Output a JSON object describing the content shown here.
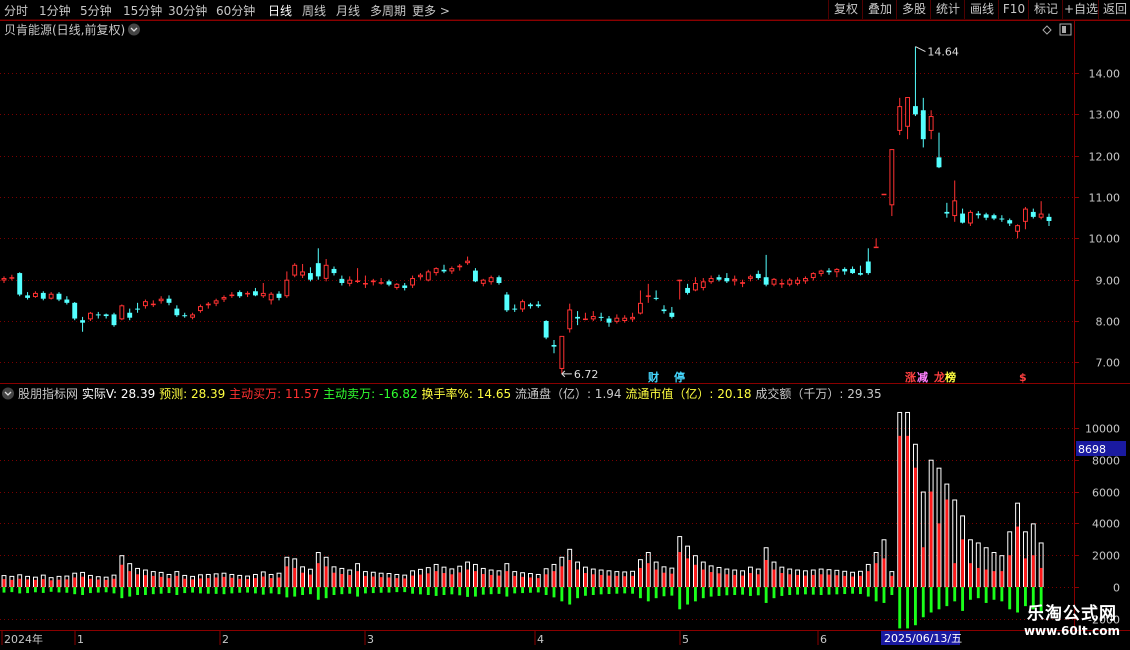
{
  "topbar": {
    "periods": [
      "分时",
      "1分钟",
      "5分钟",
      "15分钟",
      "30分钟",
      "60分钟",
      "日线",
      "周线",
      "月线",
      "多周期",
      "更多 >"
    ],
    "active_period": "日线",
    "right_buttons": [
      "复权",
      "叠加",
      "多股",
      "统计",
      "画线",
      "F10",
      "标记",
      "+自选",
      "返回"
    ]
  },
  "main_panel": {
    "title": "贝肯能源(日线,前复权)",
    "high_label": "14.64",
    "low_label": "6.72",
    "y_ticks": [
      "14.00",
      "13.00",
      "12.00",
      "11.00",
      "10.00",
      "9.00",
      "8.00",
      "7.00"
    ],
    "markers": [
      {
        "text": "财",
        "color": "#46d8ff"
      },
      {
        "text": "停",
        "color": "#46d8ff"
      },
      {
        "text": "涨",
        "color": "#ff4040"
      },
      {
        "text": "减",
        "color": "#ff80ff"
      },
      {
        "text": "龙",
        "color": "#ff4040"
      },
      {
        "text": "榜",
        "color": "#ffff40"
      },
      {
        "text": "$",
        "color": "#ff4040"
      }
    ]
  },
  "indicator_panel": {
    "name": "股朋指标网",
    "items": [
      {
        "label": "实际V",
        "value": "28.39",
        "color": "#ffffff"
      },
      {
        "label": "预测",
        "value": "28.39",
        "color": "#ffff40"
      },
      {
        "label": "主动买万",
        "value": "11.57",
        "color": "#ff3030"
      },
      {
        "label": "主动卖万",
        "value": "-16.82",
        "color": "#30ff30"
      },
      {
        "label": "换手率%",
        "value": "14.65",
        "color": "#ffff40"
      },
      {
        "label": "流通盘（亿）",
        "value": "1.94",
        "color": "#c8c8c8"
      },
      {
        "label": "流通市值（亿）",
        "value": "20.18",
        "color": "#ffff40"
      },
      {
        "label": "成交额（千万）",
        "value": "29.35",
        "color": "#c8c8c8"
      }
    ],
    "y_ticks": [
      "10000",
      "8000",
      "6000",
      "4000",
      "2000",
      "0",
      "-2000"
    ],
    "cursor_value": "8698"
  },
  "date_axis": {
    "labels": [
      "2024年",
      "1",
      "2",
      "3",
      "4",
      "5",
      "6"
    ],
    "current_date": "2025/06/13/五"
  },
  "watermark": {
    "line1": "乐淘公式网",
    "line2": "www.60lt.com"
  },
  "colors": {
    "up": "#ff3232",
    "down": "#54ffff",
    "buy": "#ff1a1a",
    "sell": "#1aff1a",
    "grid": "#7a0000",
    "axis_text": "#c8c8c8"
  },
  "chart_data": {
    "type": "candlestick",
    "y_range": [
      6.5,
      14.8
    ],
    "volume_range": [
      -2700,
      11500
    ],
    "candles": [
      [
        8.98,
        9.08,
        8.92,
        9.04
      ],
      [
        9.04,
        9.12,
        8.98,
        9.06
      ],
      [
        9.16,
        9.18,
        8.6,
        8.64
      ],
      [
        8.62,
        8.7,
        8.52,
        8.56
      ],
      [
        8.58,
        8.72,
        8.56,
        8.68
      ],
      [
        8.68,
        8.72,
        8.5,
        8.54
      ],
      [
        8.54,
        8.7,
        8.52,
        8.66
      ],
      [
        8.66,
        8.7,
        8.48,
        8.52
      ],
      [
        8.52,
        8.6,
        8.4,
        8.44
      ],
      [
        8.44,
        8.46,
        8.02,
        8.06
      ],
      [
        8.02,
        8.1,
        7.74,
        7.96
      ],
      [
        8.04,
        8.22,
        8.0,
        8.2
      ],
      [
        8.16,
        8.22,
        8.06,
        8.14
      ],
      [
        8.16,
        8.18,
        8.06,
        8.12
      ],
      [
        8.16,
        8.2,
        7.86,
        7.9
      ],
      [
        8.04,
        8.4,
        8.02,
        8.38
      ],
      [
        8.2,
        8.3,
        8.02,
        8.08
      ],
      [
        8.3,
        8.44,
        8.2,
        8.28
      ],
      [
        8.36,
        8.52,
        8.3,
        8.48
      ],
      [
        8.4,
        8.5,
        8.34,
        8.42
      ],
      [
        8.48,
        8.6,
        8.42,
        8.54
      ],
      [
        8.54,
        8.62,
        8.38,
        8.44
      ],
      [
        8.3,
        8.38,
        8.1,
        8.14
      ],
      [
        8.14,
        8.2,
        8.08,
        8.12
      ],
      [
        8.08,
        8.2,
        8.04,
        8.16
      ],
      [
        8.24,
        8.4,
        8.2,
        8.36
      ],
      [
        8.38,
        8.46,
        8.3,
        8.42
      ],
      [
        8.42,
        8.54,
        8.36,
        8.5
      ],
      [
        8.52,
        8.62,
        8.46,
        8.58
      ],
      [
        8.62,
        8.7,
        8.56,
        8.64
      ],
      [
        8.7,
        8.74,
        8.56,
        8.6
      ],
      [
        8.66,
        8.72,
        8.58,
        8.68
      ],
      [
        8.72,
        8.8,
        8.6,
        8.62
      ],
      [
        8.6,
        8.92,
        8.56,
        8.68
      ],
      [
        8.5,
        8.7,
        8.4,
        8.66
      ],
      [
        8.66,
        8.72,
        8.5,
        8.56
      ],
      [
        8.6,
        9.2,
        8.56,
        9.0
      ],
      [
        9.1,
        9.4,
        9.06,
        9.36
      ],
      [
        9.1,
        9.38,
        9.04,
        9.2
      ],
      [
        9.16,
        9.3,
        8.96,
        9.0
      ],
      [
        9.4,
        9.76,
        9.0,
        9.08
      ],
      [
        9.02,
        9.5,
        8.96,
        9.36
      ],
      [
        9.26,
        9.32,
        9.1,
        9.16
      ],
      [
        9.02,
        9.1,
        8.86,
        8.92
      ],
      [
        8.9,
        9.08,
        8.84,
        9.0
      ],
      [
        8.96,
        9.28,
        8.92,
        8.98
      ],
      [
        8.9,
        9.1,
        8.8,
        8.92
      ],
      [
        8.94,
        9.02,
        8.86,
        8.98
      ],
      [
        8.92,
        9.04,
        8.88,
        8.94
      ],
      [
        8.96,
        9.0,
        8.84,
        8.88
      ],
      [
        8.8,
        8.92,
        8.76,
        8.9
      ],
      [
        8.86,
        8.92,
        8.74,
        8.8
      ],
      [
        8.86,
        9.1,
        8.8,
        9.04
      ],
      [
        9.06,
        9.16,
        9.0,
        9.12
      ],
      [
        8.98,
        9.24,
        8.96,
        9.2
      ],
      [
        9.16,
        9.3,
        9.1,
        9.28
      ],
      [
        9.24,
        9.36,
        9.16,
        9.2
      ],
      [
        9.2,
        9.32,
        9.14,
        9.28
      ],
      [
        9.3,
        9.38,
        9.22,
        9.34
      ],
      [
        9.4,
        9.56,
        9.36,
        9.46
      ],
      [
        9.22,
        9.28,
        8.94,
        8.96
      ],
      [
        8.9,
        9.02,
        8.84,
        9.0
      ],
      [
        8.94,
        9.1,
        8.88,
        9.06
      ],
      [
        9.06,
        9.1,
        8.88,
        8.92
      ],
      [
        8.64,
        8.7,
        8.22,
        8.26
      ],
      [
        8.3,
        8.4,
        8.22,
        8.28
      ],
      [
        8.28,
        8.52,
        8.22,
        8.48
      ],
      [
        8.4,
        8.44,
        8.3,
        8.36
      ],
      [
        8.4,
        8.48,
        8.32,
        8.36
      ],
      [
        8.0,
        8.02,
        7.56,
        7.6
      ],
      [
        7.42,
        7.54,
        7.22,
        7.38
      ],
      [
        6.84,
        7.2,
        6.72,
        7.64
      ],
      [
        7.8,
        8.42,
        7.72,
        8.28
      ],
      [
        8.1,
        8.24,
        7.9,
        8.06
      ],
      [
        8.04,
        8.2,
        8.02,
        8.06
      ],
      [
        8.04,
        8.24,
        8.0,
        8.12
      ],
      [
        8.1,
        8.2,
        8.0,
        8.08
      ],
      [
        8.06,
        8.12,
        7.86,
        7.96
      ],
      [
        7.98,
        8.16,
        7.94,
        8.08
      ],
      [
        8.0,
        8.14,
        7.96,
        8.08
      ],
      [
        8.04,
        8.2,
        7.98,
        8.1
      ],
      [
        8.18,
        8.74,
        8.16,
        8.44
      ],
      [
        8.6,
        8.9,
        8.44,
        8.62
      ],
      [
        8.56,
        8.74,
        8.5,
        8.54
      ],
      [
        8.28,
        8.38,
        8.18,
        8.24
      ],
      [
        8.2,
        8.34,
        8.06,
        8.1
      ],
      [
        9.0,
        9.0,
        8.52,
        9.0
      ],
      [
        8.8,
        8.9,
        8.64,
        8.68
      ],
      [
        8.74,
        9.06,
        8.72,
        8.92
      ],
      [
        8.8,
        9.04,
        8.74,
        8.96
      ],
      [
        8.94,
        9.1,
        8.9,
        9.04
      ],
      [
        9.06,
        9.12,
        8.96,
        9.0
      ],
      [
        9.04,
        9.16,
        8.92,
        8.96
      ],
      [
        8.96,
        9.1,
        8.86,
        9.02
      ],
      [
        8.9,
        9.0,
        8.82,
        8.94
      ],
      [
        9.02,
        9.12,
        8.96,
        9.08
      ],
      [
        9.14,
        9.22,
        9.0,
        9.04
      ],
      [
        9.06,
        9.6,
        8.84,
        8.88
      ],
      [
        8.88,
        9.04,
        8.84,
        9.02
      ],
      [
        8.9,
        9.02,
        8.8,
        8.92
      ],
      [
        8.88,
        9.04,
        8.84,
        9.0
      ],
      [
        8.9,
        9.06,
        8.86,
        9.0
      ],
      [
        8.96,
        9.08,
        8.9,
        9.04
      ],
      [
        9.04,
        9.18,
        8.98,
        9.16
      ],
      [
        9.14,
        9.24,
        9.08,
        9.22
      ],
      [
        9.22,
        9.28,
        9.12,
        9.18
      ],
      [
        9.18,
        9.28,
        9.06,
        9.26
      ],
      [
        9.26,
        9.3,
        9.12,
        9.2
      ],
      [
        9.26,
        9.32,
        9.14,
        9.16
      ],
      [
        9.16,
        9.34,
        9.1,
        9.12
      ],
      [
        9.44,
        9.76,
        9.12,
        9.16
      ],
      [
        9.8,
        10.0,
        9.8,
        9.8
      ],
      [
        11.08,
        11.08,
        11.08,
        11.08
      ],
      [
        10.8,
        12.0,
        10.54,
        12.16
      ],
      [
        12.6,
        13.4,
        12.5,
        13.2
      ],
      [
        12.7,
        13.2,
        12.4,
        13.42
      ],
      [
        13.2,
        14.64,
        12.96,
        13.0
      ],
      [
        13.1,
        13.4,
        12.2,
        12.4
      ],
      [
        12.6,
        13.1,
        12.4,
        12.96
      ],
      [
        11.96,
        12.56,
        11.7,
        11.72
      ],
      [
        10.64,
        10.86,
        10.5,
        10.6
      ],
      [
        10.54,
        11.4,
        10.4,
        10.92
      ],
      [
        10.6,
        10.72,
        10.36,
        10.38
      ],
      [
        10.36,
        10.68,
        10.3,
        10.64
      ],
      [
        10.6,
        10.66,
        10.48,
        10.56
      ],
      [
        10.58,
        10.62,
        10.44,
        10.5
      ],
      [
        10.56,
        10.6,
        10.44,
        10.48
      ],
      [
        10.48,
        10.56,
        10.4,
        10.46
      ],
      [
        10.44,
        10.48,
        10.3,
        10.36
      ],
      [
        10.16,
        10.34,
        10.0,
        10.32
      ],
      [
        10.4,
        10.76,
        10.22,
        10.72
      ],
      [
        10.64,
        10.72,
        10.48,
        10.52
      ],
      [
        10.5,
        10.9,
        10.46,
        10.6
      ],
      [
        10.52,
        10.6,
        10.3,
        10.42
      ]
    ],
    "volume": [
      [
        500,
        750,
        350
      ],
      [
        450,
        700,
        320
      ],
      [
        520,
        800,
        400
      ],
      [
        480,
        700,
        380
      ],
      [
        450,
        650,
        330
      ],
      [
        500,
        780,
        370
      ],
      [
        420,
        620,
        300
      ],
      [
        460,
        700,
        340
      ],
      [
        480,
        720,
        360
      ],
      [
        600,
        900,
        450
      ],
      [
        650,
        950,
        500
      ],
      [
        520,
        760,
        380
      ],
      [
        470,
        680,
        350
      ],
      [
        450,
        650,
        330
      ],
      [
        520,
        780,
        400
      ],
      [
        1400,
        2000,
        700
      ],
      [
        1000,
        1500,
        600
      ],
      [
        800,
        1200,
        500
      ],
      [
        750,
        1100,
        500
      ],
      [
        700,
        1000,
        450
      ],
      [
        640,
        950,
        420
      ],
      [
        560,
        820,
        380
      ],
      [
        700,
        1000,
        500
      ],
      [
        520,
        760,
        380
      ],
      [
        480,
        700,
        350
      ],
      [
        540,
        800,
        400
      ],
      [
        560,
        820,
        420
      ],
      [
        600,
        860,
        430
      ],
      [
        640,
        900,
        450
      ],
      [
        580,
        820,
        400
      ],
      [
        520,
        760,
        360
      ],
      [
        500,
        720,
        350
      ],
      [
        560,
        820,
        400
      ],
      [
        660,
        980,
        480
      ],
      [
        560,
        820,
        400
      ],
      [
        600,
        900,
        450
      ],
      [
        1300,
        1900,
        650
      ],
      [
        1200,
        1800,
        600
      ],
      [
        900,
        1300,
        500
      ],
      [
        780,
        1150,
        450
      ],
      [
        1500,
        2200,
        800
      ],
      [
        1300,
        1900,
        700
      ],
      [
        900,
        1300,
        500
      ],
      [
        820,
        1200,
        450
      ],
      [
        760,
        1100,
        420
      ],
      [
        1000,
        1500,
        600
      ],
      [
        700,
        1000,
        400
      ],
      [
        660,
        960,
        380
      ],
      [
        620,
        900,
        360
      ],
      [
        600,
        880,
        350
      ],
      [
        560,
        820,
        320
      ],
      [
        540,
        780,
        320
      ],
      [
        720,
        1050,
        420
      ],
      [
        780,
        1140,
        460
      ],
      [
        860,
        1250,
        500
      ],
      [
        1000,
        1450,
        560
      ],
      [
        880,
        1280,
        500
      ],
      [
        800,
        1170,
        460
      ],
      [
        920,
        1340,
        520
      ],
      [
        1100,
        1600,
        620
      ],
      [
        1000,
        1450,
        600
      ],
      [
        820,
        1200,
        480
      ],
      [
        760,
        1100,
        450
      ],
      [
        720,
        1050,
        430
      ],
      [
        1000,
        1500,
        600
      ],
      [
        700,
        1000,
        400
      ],
      [
        640,
        930,
        380
      ],
      [
        600,
        880,
        360
      ],
      [
        560,
        820,
        340
      ],
      [
        800,
        1180,
        500
      ],
      [
        1000,
        1450,
        650
      ],
      [
        1300,
        1900,
        900
      ],
      [
        1700,
        2400,
        1100
      ],
      [
        1100,
        1600,
        700
      ],
      [
        880,
        1280,
        550
      ],
      [
        800,
        1160,
        500
      ],
      [
        760,
        1100,
        460
      ],
      [
        720,
        1050,
        440
      ],
      [
        700,
        1000,
        420
      ],
      [
        680,
        980,
        400
      ],
      [
        700,
        1020,
        420
      ],
      [
        1200,
        1750,
        700
      ],
      [
        1500,
        2200,
        900
      ],
      [
        1100,
        1600,
        700
      ],
      [
        900,
        1300,
        580
      ],
      [
        840,
        1220,
        540
      ],
      [
        2200,
        3200,
        1400
      ],
      [
        1800,
        2600,
        1100
      ],
      [
        1400,
        2000,
        900
      ],
      [
        1100,
        1600,
        700
      ],
      [
        940,
        1360,
        600
      ],
      [
        860,
        1260,
        560
      ],
      [
        800,
        1160,
        520
      ],
      [
        760,
        1100,
        500
      ],
      [
        720,
        1050,
        480
      ],
      [
        880,
        1280,
        560
      ],
      [
        800,
        1160,
        520
      ],
      [
        1700,
        2500,
        1000
      ],
      [
        1100,
        1600,
        700
      ],
      [
        880,
        1280,
        560
      ],
      [
        800,
        1160,
        500
      ],
      [
        760,
        1100,
        480
      ],
      [
        720,
        1050,
        460
      ],
      [
        760,
        1100,
        480
      ],
      [
        800,
        1160,
        500
      ],
      [
        780,
        1120,
        480
      ],
      [
        740,
        1080,
        460
      ],
      [
        700,
        1020,
        440
      ],
      [
        660,
        960,
        420
      ],
      [
        700,
        1020,
        440
      ],
      [
        1000,
        1450,
        600
      ],
      [
        1500,
        2200,
        900
      ],
      [
        1800,
        3000,
        1000
      ],
      [
        700,
        1000,
        500
      ],
      [
        9500,
        11000,
        2600
      ],
      [
        9500,
        11000,
        2600
      ],
      [
        7500,
        9000,
        2400
      ],
      [
        2500,
        6000,
        1900
      ],
      [
        6000,
        8000,
        1600
      ],
      [
        4000,
        7500,
        1400
      ],
      [
        5500,
        6500,
        1200
      ],
      [
        1500,
        5500,
        900
      ],
      [
        3000,
        4500,
        1500
      ],
      [
        1500,
        3000,
        800
      ],
      [
        1200,
        2800,
        700
      ],
      [
        1100,
        2500,
        1000
      ],
      [
        1000,
        2200,
        800
      ],
      [
        1000,
        2000,
        900
      ],
      [
        2000,
        3500,
        1400
      ],
      [
        3800,
        5300,
        1600
      ],
      [
        1800,
        3500,
        1200
      ],
      [
        2000,
        4000,
        1400
      ],
      [
        1200,
        2800,
        1600
      ]
    ]
  }
}
